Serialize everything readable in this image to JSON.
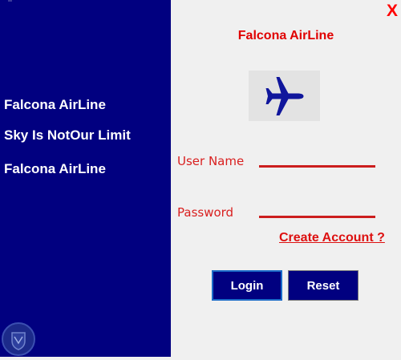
{
  "left_panel": {
    "line1": "Falcona AirLine",
    "line2": "Sky Is NotOur Limit",
    "line3": "Falcona AirLine"
  },
  "right_panel": {
    "close_label": "X",
    "title": "Falcona AirLine",
    "icon": "airplane-icon",
    "username_label": "User Name",
    "password_label": "Password",
    "username_value": "",
    "password_value": "",
    "create_account_label": "Create Account ?",
    "login_label": "Login",
    "reset_label": "Reset"
  },
  "colors": {
    "left_panel_bg": "#010080",
    "accent_red": "#e00000",
    "button_bg": "#010080"
  }
}
